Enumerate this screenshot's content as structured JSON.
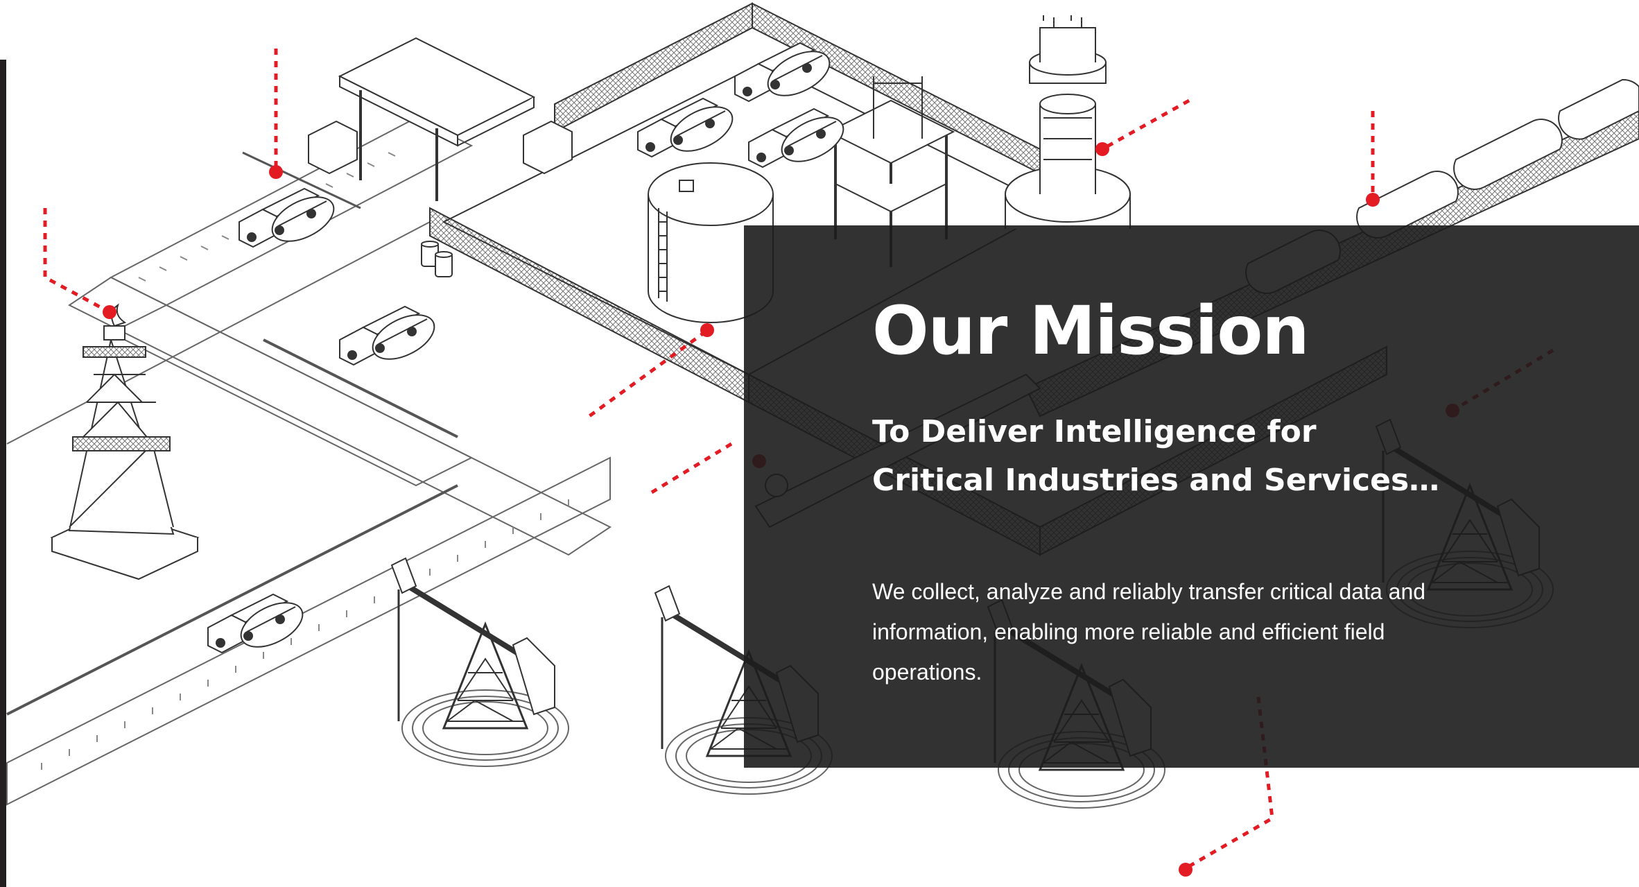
{
  "page": {
    "accent_color": "#e31b23",
    "overlay_color": "#1c1c1c"
  },
  "mission": {
    "title": "Our Mission",
    "subtitle_lines": [
      "To Deliver Intelligence for",
      "Critical Industries and Services…"
    ],
    "body_lines": [
      "We collect, analyze and reliably transfer critical data and",
      "information, enabling more reliable and efficient field",
      "operations."
    ]
  },
  "illustration": {
    "icons": [
      "oil-derrick-icon",
      "pumpjack-icon",
      "tanker-truck-icon",
      "storage-tank-icon",
      "refinery-tower-icon",
      "tank-train-icon",
      "gas-station-canopy-icon",
      "oil-barrel-icon",
      "guard-booth-icon"
    ],
    "hotspot_count": 11
  }
}
